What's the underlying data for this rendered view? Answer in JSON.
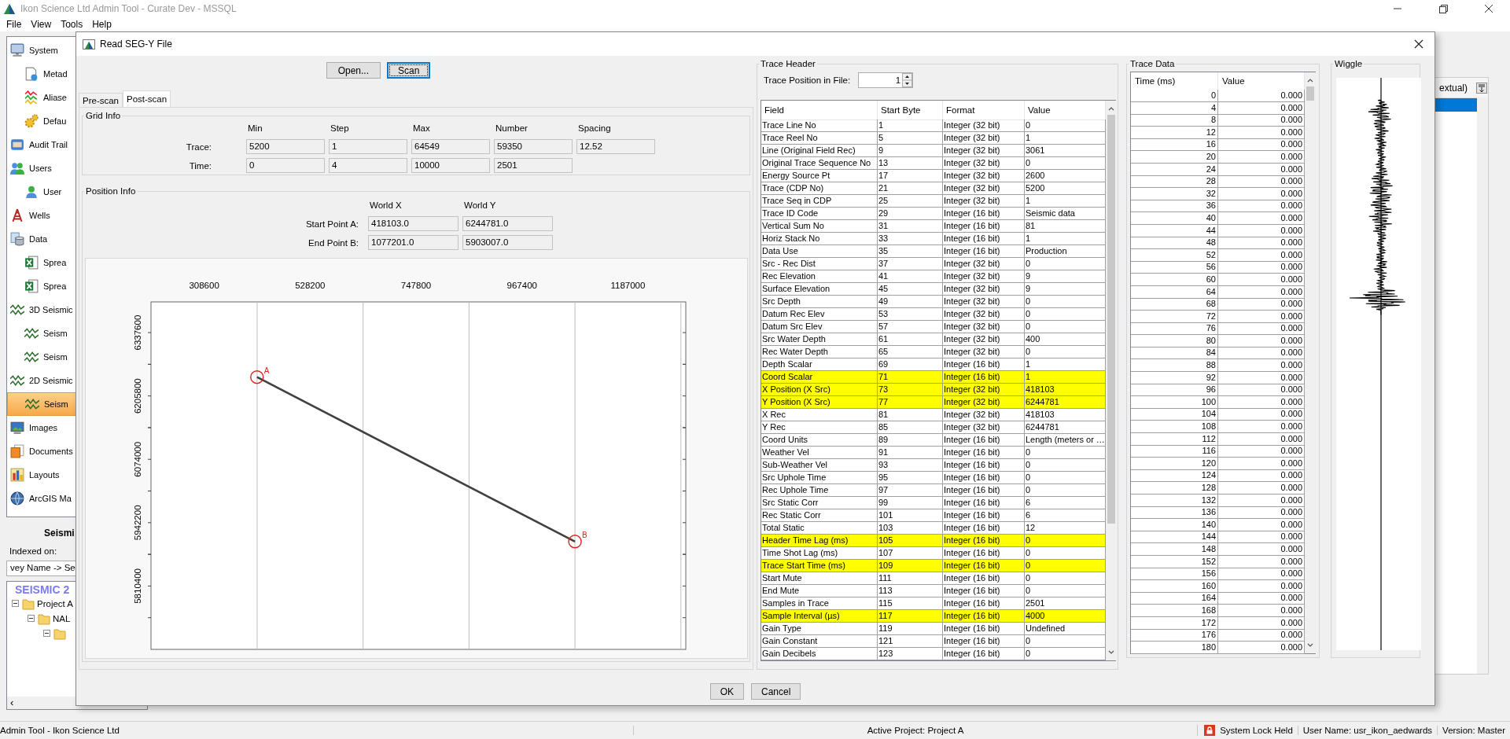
{
  "app": {
    "title": "Ikon Science Ltd Admin Tool - Curate Dev - MSSQL",
    "menu": [
      "File",
      "View",
      "Tools",
      "Help"
    ]
  },
  "sidebar": {
    "items": [
      {
        "label": "System",
        "kind": "system",
        "selected": false,
        "children": [
          {
            "label": "Metad",
            "kind": "metadata",
            "selected": false
          },
          {
            "label": "Aliase",
            "kind": "aliases",
            "selected": false
          },
          {
            "label": "Defau",
            "kind": "defaults",
            "selected": false
          }
        ]
      },
      {
        "label": "Audit Trail",
        "kind": "audit",
        "selected": false
      },
      {
        "label": "Users",
        "kind": "users",
        "selected": false,
        "children": [
          {
            "label": "User",
            "kind": "user",
            "selected": false
          }
        ]
      },
      {
        "label": "Wells",
        "kind": "wells",
        "selected": false
      },
      {
        "label": "Data",
        "kind": "data",
        "selected": false,
        "children": [
          {
            "label": "Sprea",
            "kind": "spreadsheet",
            "selected": false
          },
          {
            "label": "Sprea",
            "kind": "spreadsheet",
            "selected": false
          }
        ]
      },
      {
        "label": "3D Seismic",
        "kind": "seismic",
        "selected": false,
        "children": [
          {
            "label": "Seism",
            "kind": "seismic",
            "selected": false
          },
          {
            "label": "Seism",
            "kind": "seismic",
            "selected": false
          }
        ]
      },
      {
        "label": "2D Seismic",
        "kind": "seismic",
        "selected": false,
        "children": [
          {
            "label": "Seism",
            "kind": "seismic",
            "selected": true
          }
        ]
      },
      {
        "label": "Images",
        "kind": "images",
        "selected": false
      },
      {
        "label": "Documents",
        "kind": "documents",
        "selected": false
      },
      {
        "label": "Layouts",
        "kind": "layouts",
        "selected": false
      },
      {
        "label": "ArcGIS Ma",
        "kind": "globe",
        "selected": false
      }
    ]
  },
  "search_panel": {
    "title": "Seismi",
    "indexed_label": "Indexed on:",
    "indexed_value": "vey Name -> Se",
    "tree_title": "SEISMIC 2",
    "scroll_left": "‹",
    "tree": [
      {
        "label": "Project A",
        "expanded": true,
        "children": [
          {
            "label": "NAL",
            "expanded": true,
            "children": [
              {
                "expanded": true
              }
            ]
          }
        ]
      }
    ]
  },
  "right_panel": {
    "header": "extual)",
    "rows": [
      {
        "selected": true
      }
    ]
  },
  "dialog": {
    "title": "Read SEG-Y File",
    "buttons": [
      {
        "label": "Open...",
        "focused": false
      },
      {
        "label": "Scan",
        "focused": true
      }
    ],
    "tabs": [
      {
        "label": "Pre-scan",
        "selected": false
      },
      {
        "label": "Post-scan",
        "selected": true
      }
    ],
    "grid_info": {
      "title": "Grid Info",
      "columns": [
        "Min",
        "Step",
        "Max",
        "Number",
        "Spacing"
      ],
      "rows": [
        {
          "label": "Trace:",
          "values": [
            "5200",
            "1",
            "64549",
            "59350",
            "12.52"
          ]
        },
        {
          "label": "Time:",
          "values": [
            "0",
            "4",
            "10000",
            "2501"
          ]
        }
      ]
    },
    "position_info": {
      "title": "Position Info",
      "columns": [
        "World X",
        "World Y"
      ],
      "rows": [
        {
          "label": "Start Point A:",
          "values": [
            "418103.0",
            "6244781.0"
          ]
        },
        {
          "label": "End Point B:",
          "values": [
            "1077201.0",
            "5903007.0"
          ]
        }
      ],
      "chart_data": {
        "type": "line",
        "x": [
          418100,
          1077200
        ],
        "series": [
          {
            "color": "#404040",
            "marker": "circle",
            "values": [
              6245000,
              5903000
            ]
          }
        ],
        "xlim": [
          198400,
          1306900
        ],
        "ylim": [
          5678600,
          6401500
        ],
        "xticks": [
          308600,
          528200,
          747800,
          967400,
          1187000
        ],
        "yticks": [
          5810400,
          5942200,
          6074000,
          6205800,
          6337600
        ],
        "annotations": [
          {
            "text": "A",
            "x": 418100,
            "y": 6245000
          },
          {
            "text": "B",
            "x": 1077200,
            "y": 5903000
          }
        ]
      }
    },
    "trace_header": {
      "title": "Trace Header",
      "position_label": "Trace Position in File:",
      "position_value": "1",
      "columns": [
        "Field",
        "Start Byte",
        "Format",
        "Value"
      ],
      "rows": [
        {
          "field": "Trace Line No",
          "start_byte": "1",
          "format": "Integer (32 bit)",
          "value": "0",
          "highlighted": false
        },
        {
          "field": "Trace Reel No",
          "start_byte": "5",
          "format": "Integer (32 bit)",
          "value": "1",
          "highlighted": false
        },
        {
          "field": "Line (Original Field Rec)",
          "start_byte": "9",
          "format": "Integer (32 bit)",
          "value": "3061",
          "highlighted": false
        },
        {
          "field": "Original Trace Sequence No",
          "start_byte": "13",
          "format": "Integer (32 bit)",
          "value": "0",
          "highlighted": false
        },
        {
          "field": "Energy Source Pt",
          "start_byte": "17",
          "format": "Integer (32 bit)",
          "value": "2600",
          "highlighted": false
        },
        {
          "field": "Trace (CDP No)",
          "start_byte": "21",
          "format": "Integer (32 bit)",
          "value": "5200",
          "highlighted": false
        },
        {
          "field": "Trace Seq in CDP",
          "start_byte": "25",
          "format": "Integer (32 bit)",
          "value": "1",
          "highlighted": false
        },
        {
          "field": "Trace ID Code",
          "start_byte": "29",
          "format": "Integer (16 bit)",
          "value": "Seismic data",
          "highlighted": false
        },
        {
          "field": "Vertical Sum No",
          "start_byte": "31",
          "format": "Integer (16 bit)",
          "value": "81",
          "highlighted": false
        },
        {
          "field": "Horiz Stack No",
          "start_byte": "33",
          "format": "Integer (16 bit)",
          "value": "1",
          "highlighted": false
        },
        {
          "field": "Data Use",
          "start_byte": "35",
          "format": "Integer (16 bit)",
          "value": "Production",
          "highlighted": false
        },
        {
          "field": "Src - Rec Dist",
          "start_byte": "37",
          "format": "Integer (32 bit)",
          "value": "0",
          "highlighted": false
        },
        {
          "field": "Rec Elevation",
          "start_byte": "41",
          "format": "Integer (32 bit)",
          "value": "9",
          "highlighted": false
        },
        {
          "field": "Surface Elevation",
          "start_byte": "45",
          "format": "Integer (32 bit)",
          "value": "9",
          "highlighted": false
        },
        {
          "field": "Src Depth",
          "start_byte": "49",
          "format": "Integer (32 bit)",
          "value": "0",
          "highlighted": false
        },
        {
          "field": "Datum Rec Elev",
          "start_byte": "53",
          "format": "Integer (32 bit)",
          "value": "0",
          "highlighted": false
        },
        {
          "field": "Datum Src Elev",
          "start_byte": "57",
          "format": "Integer (32 bit)",
          "value": "0",
          "highlighted": false
        },
        {
          "field": "Src Water Depth",
          "start_byte": "61",
          "format": "Integer (32 bit)",
          "value": "400",
          "highlighted": false
        },
        {
          "field": "Rec Water Depth",
          "start_byte": "65",
          "format": "Integer (32 bit)",
          "value": "0",
          "highlighted": false
        },
        {
          "field": "Depth Scalar",
          "start_byte": "69",
          "format": "Integer (16 bit)",
          "value": "1",
          "highlighted": false
        },
        {
          "field": "Coord Scalar",
          "start_byte": "71",
          "format": "Integer (16 bit)",
          "value": "1",
          "highlighted": true
        },
        {
          "field": "X Position (X Src)",
          "start_byte": "73",
          "format": "Integer (32 bit)",
          "value": "418103",
          "highlighted": true
        },
        {
          "field": "Y Position (X Src)",
          "start_byte": "77",
          "format": "Integer (32 bit)",
          "value": "6244781",
          "highlighted": true
        },
        {
          "field": "X Rec",
          "start_byte": "81",
          "format": "Integer (32 bit)",
          "value": "418103",
          "highlighted": false
        },
        {
          "field": "Y Rec",
          "start_byte": "85",
          "format": "Integer (32 bit)",
          "value": "6244781",
          "highlighted": false
        },
        {
          "field": "Coord Units",
          "start_byte": "89",
          "format": "Integer (16 bit)",
          "value": "Length (meters or …",
          "highlighted": false
        },
        {
          "field": "Weather Vel",
          "start_byte": "91",
          "format": "Integer (16 bit)",
          "value": "0",
          "highlighted": false
        },
        {
          "field": "Sub-Weather Vel",
          "start_byte": "93",
          "format": "Integer (16 bit)",
          "value": "0",
          "highlighted": false
        },
        {
          "field": "Src Uphole Time",
          "start_byte": "95",
          "format": "Integer (16 bit)",
          "value": "0",
          "highlighted": false
        },
        {
          "field": "Rec Uphole Time",
          "start_byte": "97",
          "format": "Integer (16 bit)",
          "value": "0",
          "highlighted": false
        },
        {
          "field": "Src Static Corr",
          "start_byte": "99",
          "format": "Integer (16 bit)",
          "value": "6",
          "highlighted": false
        },
        {
          "field": "Rec Static Corr",
          "start_byte": "101",
          "format": "Integer (16 bit)",
          "value": "6",
          "highlighted": false
        },
        {
          "field": "Total Static",
          "start_byte": "103",
          "format": "Integer (16 bit)",
          "value": "12",
          "highlighted": false
        },
        {
          "field": "Header Time Lag (ms)",
          "start_byte": "105",
          "format": "Integer (16 bit)",
          "value": "0",
          "highlighted": true
        },
        {
          "field": "Time Shot Lag (ms)",
          "start_byte": "107",
          "format": "Integer (16 bit)",
          "value": "0",
          "highlighted": false
        },
        {
          "field": "Trace Start Time (ms)",
          "start_byte": "109",
          "format": "Integer (16 bit)",
          "value": "0",
          "highlighted": true
        },
        {
          "field": "Start Mute",
          "start_byte": "111",
          "format": "Integer (16 bit)",
          "value": "0",
          "highlighted": false
        },
        {
          "field": "End Mute",
          "start_byte": "113",
          "format": "Integer (16 bit)",
          "value": "0",
          "highlighted": false
        },
        {
          "field": "Samples in Trace",
          "start_byte": "115",
          "format": "Integer (16 bit)",
          "value": "2501",
          "highlighted": false
        },
        {
          "field": "Sample Interval (µs)",
          "start_byte": "117",
          "format": "Integer (16 bit)",
          "value": "4000",
          "highlighted": true
        },
        {
          "field": "Gain Type",
          "start_byte": "119",
          "format": "Integer (16 bit)",
          "value": "Undefined",
          "highlighted": false
        },
        {
          "field": "Gain Constant",
          "start_byte": "121",
          "format": "Integer (16 bit)",
          "value": "0",
          "highlighted": false
        },
        {
          "field": "Gain Decibels",
          "start_byte": "123",
          "format": "Integer (16 bit)",
          "value": "0",
          "highlighted": false
        }
      ]
    },
    "trace_data": {
      "title": "Trace Data",
      "columns": [
        "Time (ms)",
        "Value"
      ],
      "rows": [
        [
          "0",
          "0.000"
        ],
        [
          "4",
          "0.000"
        ],
        [
          "8",
          "0.000"
        ],
        [
          "12",
          "0.000"
        ],
        [
          "16",
          "0.000"
        ],
        [
          "20",
          "0.000"
        ],
        [
          "24",
          "0.000"
        ],
        [
          "28",
          "0.000"
        ],
        [
          "32",
          "0.000"
        ],
        [
          "36",
          "0.000"
        ],
        [
          "40",
          "0.000"
        ],
        [
          "44",
          "0.000"
        ],
        [
          "48",
          "0.000"
        ],
        [
          "52",
          "0.000"
        ],
        [
          "56",
          "0.000"
        ],
        [
          "60",
          "0.000"
        ],
        [
          "64",
          "0.000"
        ],
        [
          "68",
          "0.000"
        ],
        [
          "72",
          "0.000"
        ],
        [
          "76",
          "0.000"
        ],
        [
          "80",
          "0.000"
        ],
        [
          "84",
          "0.000"
        ],
        [
          "88",
          "0.000"
        ],
        [
          "92",
          "0.000"
        ],
        [
          "96",
          "0.000"
        ],
        [
          "100",
          "0.000"
        ],
        [
          "104",
          "0.000"
        ],
        [
          "108",
          "0.000"
        ],
        [
          "112",
          "0.000"
        ],
        [
          "116",
          "0.000"
        ],
        [
          "120",
          "0.000"
        ],
        [
          "124",
          "0.000"
        ],
        [
          "128",
          "0.000"
        ],
        [
          "132",
          "0.000"
        ],
        [
          "136",
          "0.000"
        ],
        [
          "140",
          "0.000"
        ],
        [
          "144",
          "0.000"
        ],
        [
          "148",
          "0.000"
        ],
        [
          "152",
          "0.000"
        ],
        [
          "156",
          "0.000"
        ],
        [
          "160",
          "0.000"
        ],
        [
          "164",
          "0.000"
        ],
        [
          "168",
          "0.000"
        ],
        [
          "172",
          "0.000"
        ],
        [
          "176",
          "0.000"
        ],
        [
          "180",
          "0.000"
        ]
      ]
    },
    "wiggle": {
      "title": "Wiggle"
    },
    "footer_buttons": [
      "OK",
      "Cancel"
    ]
  },
  "status_bar": {
    "left": "Admin Tool - Ikon Science Ltd",
    "center": "Active Project: Project A",
    "lock": "System Lock Held",
    "user": "User Name: usr_ikon_aedwards",
    "version": "Version: Master"
  }
}
